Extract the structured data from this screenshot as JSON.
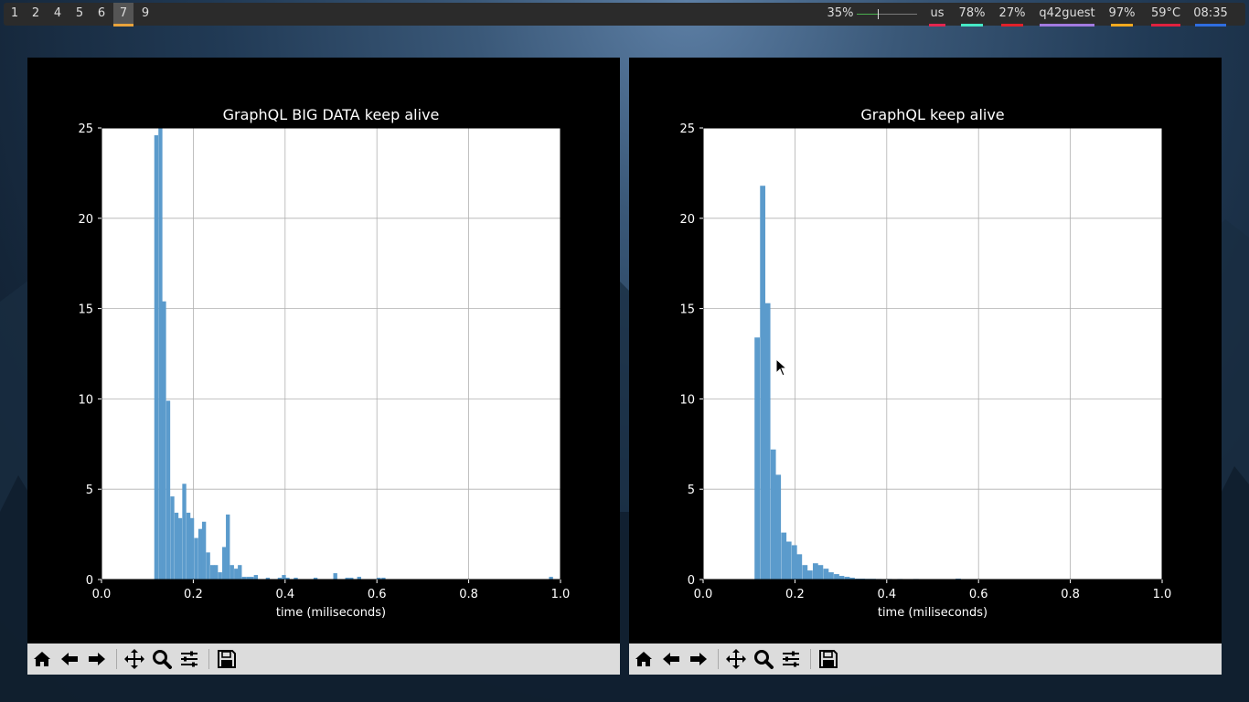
{
  "topbar": {
    "workspaces": [
      {
        "label": "1",
        "active": false
      },
      {
        "label": "2",
        "active": false
      },
      {
        "label": "4",
        "active": false
      },
      {
        "label": "5",
        "active": false
      },
      {
        "label": "6",
        "active": false
      },
      {
        "label": "7",
        "active": true
      },
      {
        "label": "9",
        "active": false
      }
    ],
    "volume": {
      "label": "35%",
      "level": 0.35
    },
    "status": [
      {
        "name": "keyboard-layout",
        "text": "us",
        "color": "#e3264f"
      },
      {
        "name": "cpu",
        "text": "78%",
        "color": "#46e8c6"
      },
      {
        "name": "memory",
        "text": "27%",
        "color": "#e0212a"
      },
      {
        "name": "user",
        "text": "q42guest",
        "color": "#a27ae0"
      },
      {
        "name": "battery",
        "text": "97%",
        "color": "#f2a91f"
      },
      {
        "name": "temperature",
        "text": "59°C",
        "color": "#e0213f"
      },
      {
        "name": "clock",
        "text": "08:35",
        "color": "#2f6de0"
      }
    ]
  },
  "colors": {
    "bar": "#5b9bcc",
    "toolbar": "#dcdcdc",
    "figure_bg": "#000000"
  },
  "toolbar_icons": [
    "home-icon",
    "back-icon",
    "forward-icon",
    "pan-icon",
    "zoom-icon",
    "configure-subplots-icon",
    "save-icon"
  ],
  "windows": [
    {
      "chart_data": {
        "type": "bar",
        "title": "GraphQL BIG DATA keep alive",
        "xlabel": "time (miliseconds)",
        "ylabel": "",
        "xlim": [
          0,
          1
        ],
        "ylim": [
          0,
          25
        ],
        "xticks": [
          "0.0",
          "0.2",
          "0.4",
          "0.6",
          "0.8",
          "1.0"
        ],
        "yticks": [
          "0",
          "5",
          "10",
          "15",
          "20",
          "25"
        ],
        "grid": true,
        "bin_width": 0.0087,
        "bins": [
          [
            0.115,
            24.6
          ],
          [
            0.124,
            25.0
          ],
          [
            0.132,
            15.4
          ],
          [
            0.141,
            9.9
          ],
          [
            0.15,
            4.6
          ],
          [
            0.159,
            3.7
          ],
          [
            0.167,
            3.4
          ],
          [
            0.176,
            5.3
          ],
          [
            0.185,
            3.7
          ],
          [
            0.193,
            3.4
          ],
          [
            0.202,
            2.3
          ],
          [
            0.211,
            2.8
          ],
          [
            0.219,
            3.2
          ],
          [
            0.228,
            1.5
          ],
          [
            0.237,
            0.8
          ],
          [
            0.245,
            0.8
          ],
          [
            0.254,
            0.4
          ],
          [
            0.263,
            1.8
          ],
          [
            0.271,
            3.6
          ],
          [
            0.28,
            0.8
          ],
          [
            0.289,
            0.6
          ],
          [
            0.297,
            0.8
          ],
          [
            0.306,
            0.15
          ],
          [
            0.315,
            0.15
          ],
          [
            0.323,
            0.15
          ],
          [
            0.332,
            0.25
          ],
          [
            0.358,
            0.1
          ],
          [
            0.384,
            0.1
          ],
          [
            0.393,
            0.25
          ],
          [
            0.401,
            0.1
          ],
          [
            0.419,
            0.1
          ],
          [
            0.462,
            0.1
          ],
          [
            0.505,
            0.35
          ],
          [
            0.531,
            0.1
          ],
          [
            0.54,
            0.1
          ],
          [
            0.557,
            0.15
          ],
          [
            0.6,
            0.1
          ],
          [
            0.61,
            0.1
          ],
          [
            0.975,
            0.15
          ]
        ]
      }
    },
    {
      "chart_data": {
        "type": "bar",
        "title": "GraphQL keep alive",
        "xlabel": "time (miliseconds)",
        "ylabel": "",
        "xlim": [
          0,
          1
        ],
        "ylim": [
          0,
          25
        ],
        "xticks": [
          "0.0",
          "0.2",
          "0.4",
          "0.6",
          "0.8",
          "1.0"
        ],
        "yticks": [
          "0",
          "5",
          "10",
          "15",
          "20",
          "25"
        ],
        "grid": true,
        "bin_width": 0.0115,
        "bins": [
          [
            0.112,
            13.4
          ],
          [
            0.124,
            21.8
          ],
          [
            0.135,
            15.3
          ],
          [
            0.147,
            7.2
          ],
          [
            0.158,
            5.8
          ],
          [
            0.17,
            2.6
          ],
          [
            0.181,
            2.1
          ],
          [
            0.193,
            1.9
          ],
          [
            0.204,
            1.4
          ],
          [
            0.216,
            0.8
          ],
          [
            0.227,
            0.5
          ],
          [
            0.239,
            0.9
          ],
          [
            0.25,
            0.8
          ],
          [
            0.262,
            0.6
          ],
          [
            0.273,
            0.4
          ],
          [
            0.285,
            0.3
          ],
          [
            0.296,
            0.2
          ],
          [
            0.308,
            0.15
          ],
          [
            0.319,
            0.1
          ],
          [
            0.331,
            0.05
          ],
          [
            0.342,
            0.05
          ],
          [
            0.354,
            0.04
          ],
          [
            0.365,
            0.04
          ],
          [
            0.377,
            0.03
          ],
          [
            0.4,
            0.03
          ],
          [
            0.423,
            0.03
          ],
          [
            0.458,
            0.03
          ],
          [
            0.55,
            0.05
          ]
        ]
      }
    }
  ]
}
